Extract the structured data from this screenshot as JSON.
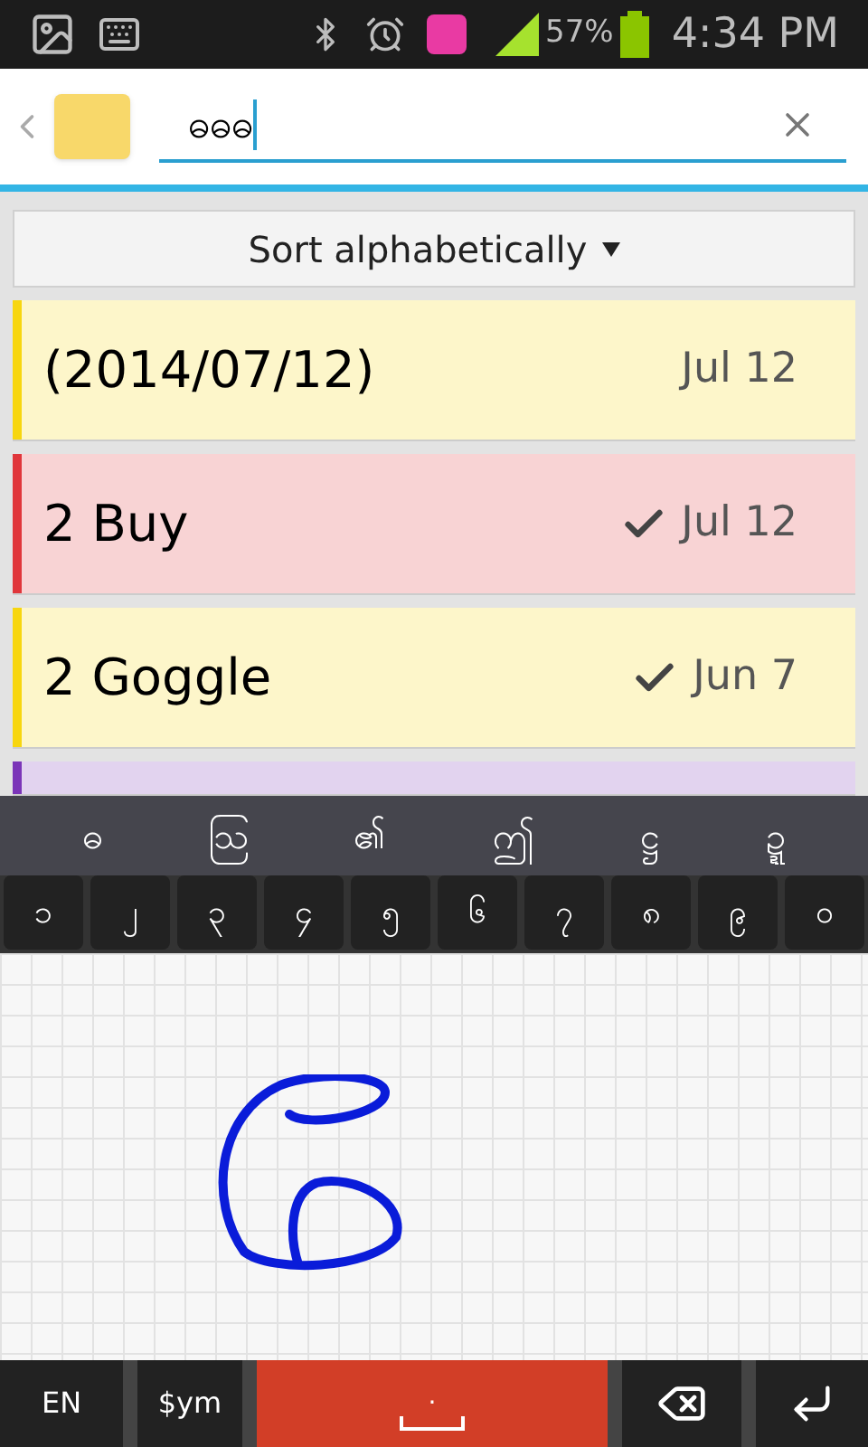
{
  "status_bar": {
    "battery": "57%",
    "time": "4:34 PM"
  },
  "search": {
    "value": "ဓဓဓ"
  },
  "sort": {
    "label": "Sort alphabetically"
  },
  "notes": [
    {
      "title": "(2014/07/12)",
      "date": "Jul 12",
      "checked": false,
      "color": "#f7d60f"
    },
    {
      "title": "2 Buy",
      "date": "Jul 12",
      "checked": true,
      "color": "#e0363b"
    },
    {
      "title": "2 Goggle",
      "date": "Jun 7",
      "checked": true,
      "color": "#f7d60f"
    },
    {
      "color": "#7b35b8"
    }
  ],
  "keyboard": {
    "candidates": [
      "ဓ",
      "ဩ",
      "၏",
      "ဤ",
      "ဋ္ဌ",
      "ဍ္ဍ"
    ],
    "digits": [
      "၁",
      "၂",
      "၃",
      "၄",
      "၅",
      "၆",
      "၇",
      "၈",
      "၉",
      "၀"
    ],
    "language_key": "EN",
    "symbols_key": "$ym",
    "space_key": "."
  }
}
